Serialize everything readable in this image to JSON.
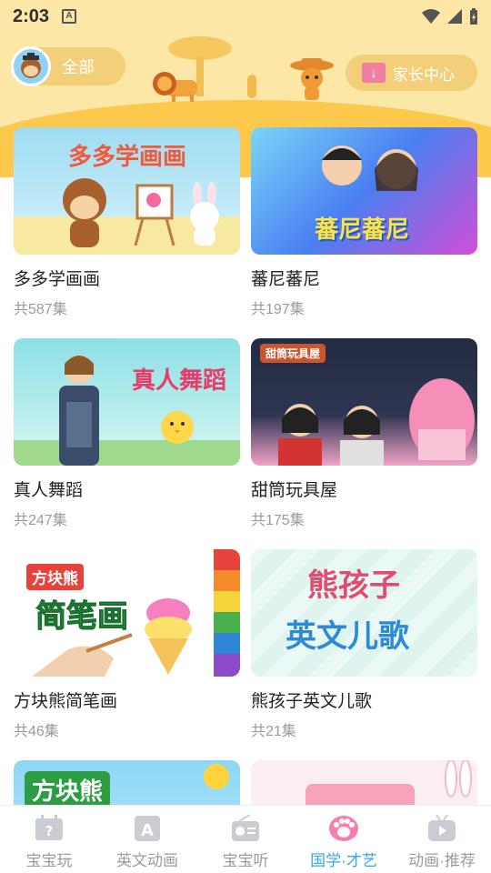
{
  "status": {
    "time": "2:03"
  },
  "header": {
    "category_label": "全部",
    "parent_center_label": "家长中心"
  },
  "cards": [
    {
      "title": "多多学画画",
      "count": "共587集",
      "thumb_text": "多多学画画"
    },
    {
      "title": "蕃尼蕃尼",
      "count": "共197集",
      "thumb_text": "蕃尼蕃尼"
    },
    {
      "title": "真人舞蹈",
      "count": "共247集",
      "thumb_text": "真人舞蹈"
    },
    {
      "title": "甜筒玩具屋",
      "count": "共175集",
      "thumb_text": "甜筒玩具屋"
    },
    {
      "title": "方块熊简笔画",
      "count": "共46集",
      "thumb_text_top": "方块熊",
      "thumb_text": "简笔画"
    },
    {
      "title": "熊孩子英文儿歌",
      "count": "共21集",
      "thumb_text_top": "熊孩子",
      "thumb_text": "英文儿歌"
    },
    {
      "title": "",
      "count": "",
      "thumb_text": "方块熊"
    },
    {
      "title": "",
      "count": "",
      "thumb_text": ""
    }
  ],
  "nav": [
    {
      "label": "宝宝玩",
      "icon": "question-card-icon",
      "active": false
    },
    {
      "label": "英文动画",
      "icon": "letter-a-icon",
      "active": false
    },
    {
      "label": "宝宝听",
      "icon": "radio-icon",
      "active": false
    },
    {
      "label": "国学·才艺",
      "icon": "paw-icon",
      "active": true
    },
    {
      "label": "动画·推荐",
      "icon": "tv-play-icon",
      "active": false
    }
  ],
  "colors": {
    "active": "#36a8e6",
    "inactive": "#9b9b9b",
    "banner": "#fde7a6"
  }
}
